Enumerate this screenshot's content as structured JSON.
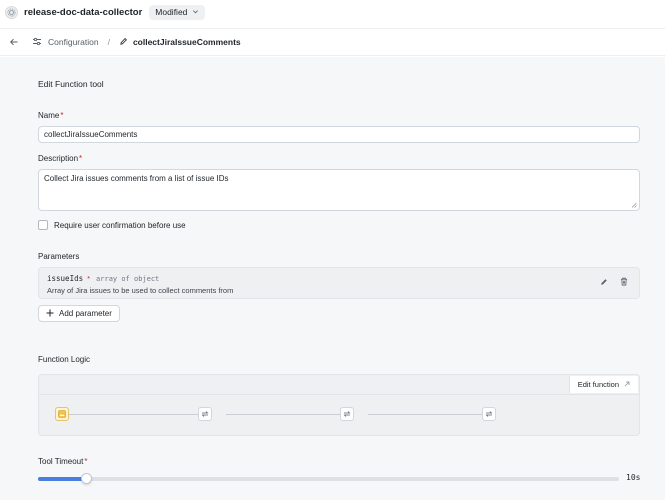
{
  "app": {
    "name": "release-doc-data-collector",
    "status": "Modified"
  },
  "breadcrumb": {
    "parent": "Configuration",
    "current": "collectJiraIssueComments"
  },
  "form": {
    "title": "Edit Function tool",
    "name_label": "Name",
    "name_value": "collectJiraIssueComments",
    "description_label": "Description",
    "description_value": "Collect Jira issues comments from a list of issue IDs",
    "confirm_label": "Require user confirmation before use",
    "confirm_checked": false,
    "parameters_label": "Parameters",
    "parameters": [
      {
        "name": "issueIds",
        "required_mark": "*",
        "type": "array of object",
        "description": "Array of Jira issues to be used to collect comments from"
      }
    ],
    "add_parameter_label": "Add parameter",
    "function_logic_label": "Function Logic",
    "edit_function_label": "Edit function",
    "timeout_label": "Tool Timeout",
    "timeout_value": "10s",
    "timeout_fraction": 0.083
  },
  "icons": {
    "app": "gear-icon",
    "status_dropdown": "chevron-down-icon",
    "back": "arrow-left-icon",
    "configuration": "sliders-icon",
    "current": "pencil-icon",
    "param_edit": "pencil-icon",
    "param_delete": "trash-icon",
    "add": "plus-icon",
    "external": "arrow-up-right-icon",
    "flow_start": "image-icon",
    "flow_step": "loop-icon"
  },
  "colors": {
    "required": "#cf222e",
    "accent": "#4a7fe0",
    "start_node": "#fff4d6"
  }
}
